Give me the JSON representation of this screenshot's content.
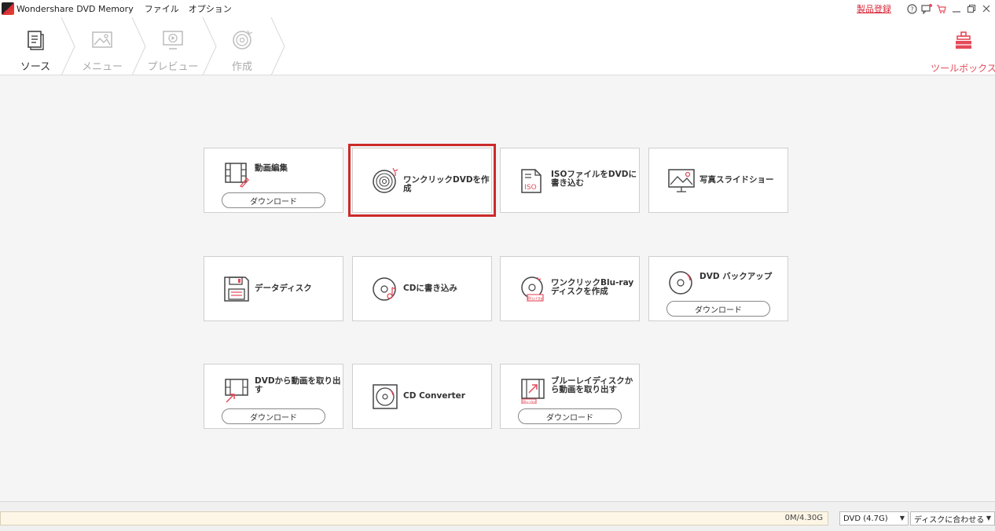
{
  "titlebar": {
    "app_title": "Wondershare DVD Memory",
    "menu": [
      "ファイル",
      "オプション"
    ],
    "register": "製品登録",
    "icons": [
      "help-icon",
      "feedback-icon",
      "cart-icon",
      "minimize-icon",
      "restore-icon",
      "close-icon"
    ]
  },
  "steps": [
    {
      "label": "ソース",
      "icon": "source-icon",
      "active": true
    },
    {
      "label": "メニュー",
      "icon": "menu-image-icon",
      "active": false
    },
    {
      "label": "プレビュー",
      "icon": "preview-icon",
      "active": false
    },
    {
      "label": "作成",
      "icon": "burn-disc-icon",
      "active": false
    }
  ],
  "toolbox": {
    "label": "ツールボックス",
    "icon": "toolbox-icon"
  },
  "cards": [
    {
      "title": "動画編集",
      "icon": "video-edit-icon",
      "download": "ダウンロード"
    },
    {
      "title": "ワンクリックDVDを作成",
      "icon": "one-click-dvd-icon",
      "selected": true
    },
    {
      "title": "ISOファイルをDVDに書き込む",
      "icon": "iso-file-icon"
    },
    {
      "title": "写真スライドショー",
      "icon": "photo-slideshow-icon"
    },
    {
      "title": "データディスク",
      "icon": "data-disc-icon"
    },
    {
      "title": "CDに書き込み",
      "icon": "cd-burn-icon"
    },
    {
      "title": "ワンクリックBlu-rayディスクを作成",
      "icon": "one-click-bluray-icon"
    },
    {
      "title": "DVD バックアップ",
      "icon": "dvd-backup-icon",
      "download": "ダウンロード"
    },
    {
      "title": "DVDから動画を取り出す",
      "icon": "dvd-rip-icon",
      "download": "ダウンロード"
    },
    {
      "title": "CD Converter",
      "icon": "cd-converter-icon"
    },
    {
      "title": "ブルーレイディスクから動画を取り出す",
      "icon": "bluray-rip-icon",
      "download": "ダウンロード"
    }
  ],
  "status": {
    "capacity": "0M/4.30G",
    "disc_type": "DVD (4.7G)",
    "fit_mode": "ディスクに合わせる"
  },
  "colors": {
    "accent": "#e54a5a",
    "selected_border": "#cc2a2a"
  }
}
